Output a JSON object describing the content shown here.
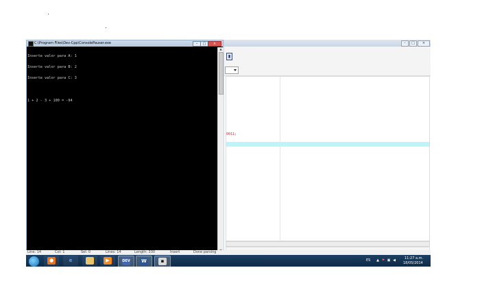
{
  "console": {
    "title": "C:\\Program Files\\Dev-Cpp\\ConsolePauser.exe",
    "lines": [
      "Inserte valor para A: 1",
      "Inserte valor para B: 2",
      "Inserte valor para C: 3",
      "",
      "1 + 2 - 3 + 100 = -94"
    ]
  },
  "ide": {
    "code_fragment": "0011;"
  },
  "statusbar": {
    "line": "Line:   14",
    "col": "Col:   1",
    "sel": "Sel:   0",
    "lines": "Lines:   14",
    "length": "Length:   330",
    "mode": "Insert",
    "state": "Done parsing"
  },
  "taskbar": {
    "apps": [
      {
        "name": "firefox",
        "icon": "firefox-icon"
      },
      {
        "name": "internet-explorer",
        "icon": "ie-icon"
      },
      {
        "name": "explorer",
        "icon": "folder-icon"
      },
      {
        "name": "media-player",
        "icon": "media-player-icon"
      },
      {
        "name": "dev-cpp",
        "icon": "dev-cpp-icon"
      },
      {
        "name": "word",
        "icon": "word-icon"
      },
      {
        "name": "console",
        "icon": "console-icon"
      }
    ],
    "language": "ES",
    "time": "11:27 a.m.",
    "date": "18/05/2014"
  }
}
